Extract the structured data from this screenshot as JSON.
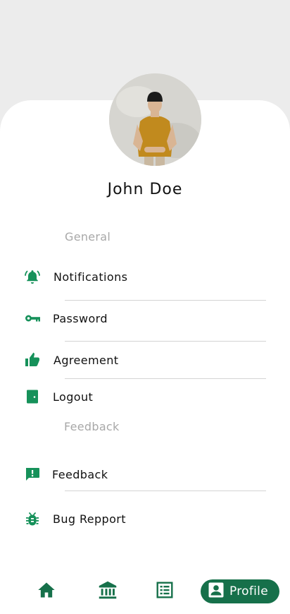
{
  "profile": {
    "name": "John Doe"
  },
  "sections": {
    "general": "General",
    "feedback": "Feedback"
  },
  "menu": {
    "notifications": "Notifications",
    "password": "Password",
    "agreement": "Agreement",
    "logout": "Logout",
    "feedback": "Feedback",
    "bug_report": "Bug Repport"
  },
  "bottom_nav": {
    "items": [
      {
        "icon": "home-icon",
        "active": false
      },
      {
        "icon": "bank-icon",
        "active": false
      },
      {
        "icon": "list-icon",
        "active": false
      },
      {
        "icon": "profile-icon",
        "active": true,
        "label": "Profile"
      }
    ]
  },
  "colors": {
    "accent": "#16704a",
    "icon_green": "#16915a",
    "background_top": "#ececec",
    "section_label": "#a8a8a8"
  }
}
